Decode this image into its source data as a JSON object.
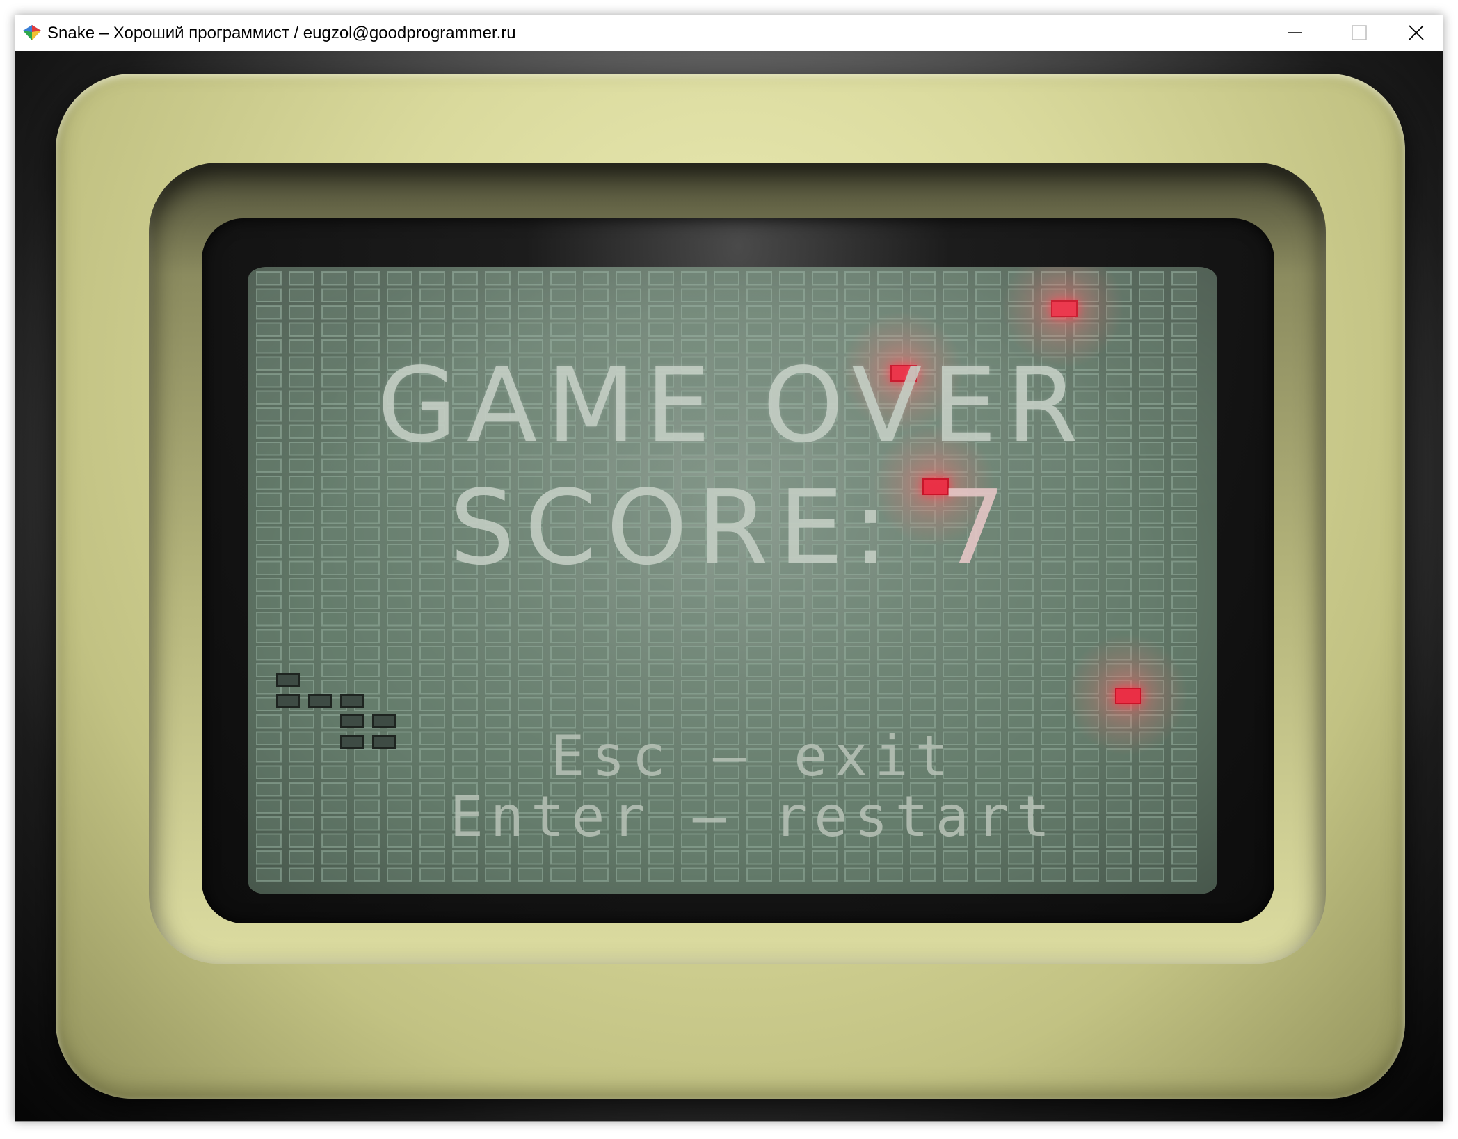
{
  "window": {
    "title": "Snake – Хороший программист / eugzol@goodprogrammer.ru"
  },
  "titlebar_buttons": {
    "minimize_icon": "minimize-icon",
    "maximize_icon": "maximize-icon",
    "close_icon": "close-icon"
  },
  "game": {
    "status": "GAME OVER",
    "score_label": "SCORE:",
    "score_value": "7",
    "hint_exit": "Esc – exit",
    "hint_restart": "Enter – restart",
    "colors": {
      "screen": "#627868",
      "food": "#ea2f45",
      "snake": "#3e4b44",
      "text": "#c5cfc5",
      "bezel": "#d9d99c"
    },
    "snake_cells": [
      [
        0,
        0
      ],
      [
        0,
        1
      ],
      [
        1,
        1
      ],
      [
        2,
        1
      ],
      [
        2,
        2
      ],
      [
        3,
        2
      ],
      [
        2,
        3
      ],
      [
        3,
        3
      ]
    ],
    "food_cells": [
      [
        25,
        2
      ],
      [
        20,
        6
      ],
      [
        21,
        13
      ],
      [
        27,
        26
      ]
    ]
  }
}
